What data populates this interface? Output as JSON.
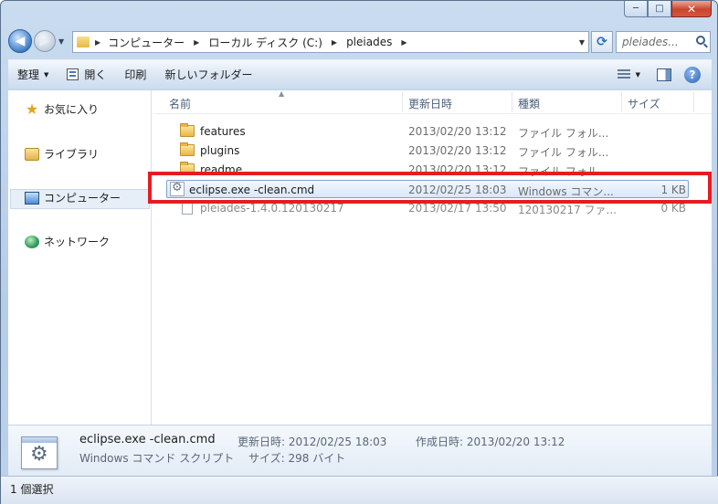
{
  "window": {
    "minimize_label": "─",
    "maximize_label": "□",
    "close_label": "✕"
  },
  "address": {
    "crumbs": [
      "コンピューター",
      "ローカル ディスク (C:)",
      "pleiades"
    ],
    "search_placeholder": "pleiades..."
  },
  "toolbar": {
    "organize_label": "整理",
    "open_label": "開く",
    "print_label": "印刷",
    "new_folder_label": "新しいフォルダー"
  },
  "nav_pane": {
    "favorites": "お気に入り",
    "libraries": "ライブラリ",
    "computer": "コンピューター",
    "network": "ネットワーク"
  },
  "columns": {
    "name": "名前",
    "date": "更新日時",
    "type": "種類",
    "size": "サイズ"
  },
  "files": [
    {
      "name": "features",
      "date": "2013/02/20 13:12",
      "type": "ファイル フォル...",
      "size": "",
      "icon": "folder-icon"
    },
    {
      "name": "plugins",
      "date": "2013/02/20 13:12",
      "type": "ファイル フォル...",
      "size": "",
      "icon": "folder-icon"
    },
    {
      "name": "readme",
      "date": "2013/02/20 13:12",
      "type": "ファイル フォル...",
      "size": "",
      "icon": "folder-icon"
    },
    {
      "name": "eclipse.exe -clean.cmd",
      "date": "2012/02/25 18:03",
      "type": "Windows コマン...",
      "size": "1 KB",
      "icon": "script-icon"
    },
    {
      "name": "pleiades-1.4.0.120130217",
      "date": "2013/02/17 13:50",
      "type": "120130217 ファ...",
      "size": "0 KB",
      "icon": "file-icon"
    }
  ],
  "details": {
    "name": "eclipse.exe -clean.cmd",
    "kind": "Windows コマンド スクリプト",
    "modified": "更新日時: 2012/02/25 18:03",
    "created": "作成日時: 2013/02/20 13:12",
    "size": "サイズ: 298 バイト"
  },
  "status": {
    "text": "1 個選択"
  },
  "colors": {
    "highlight": "#e51d22",
    "selection": "#d8e8fb"
  }
}
